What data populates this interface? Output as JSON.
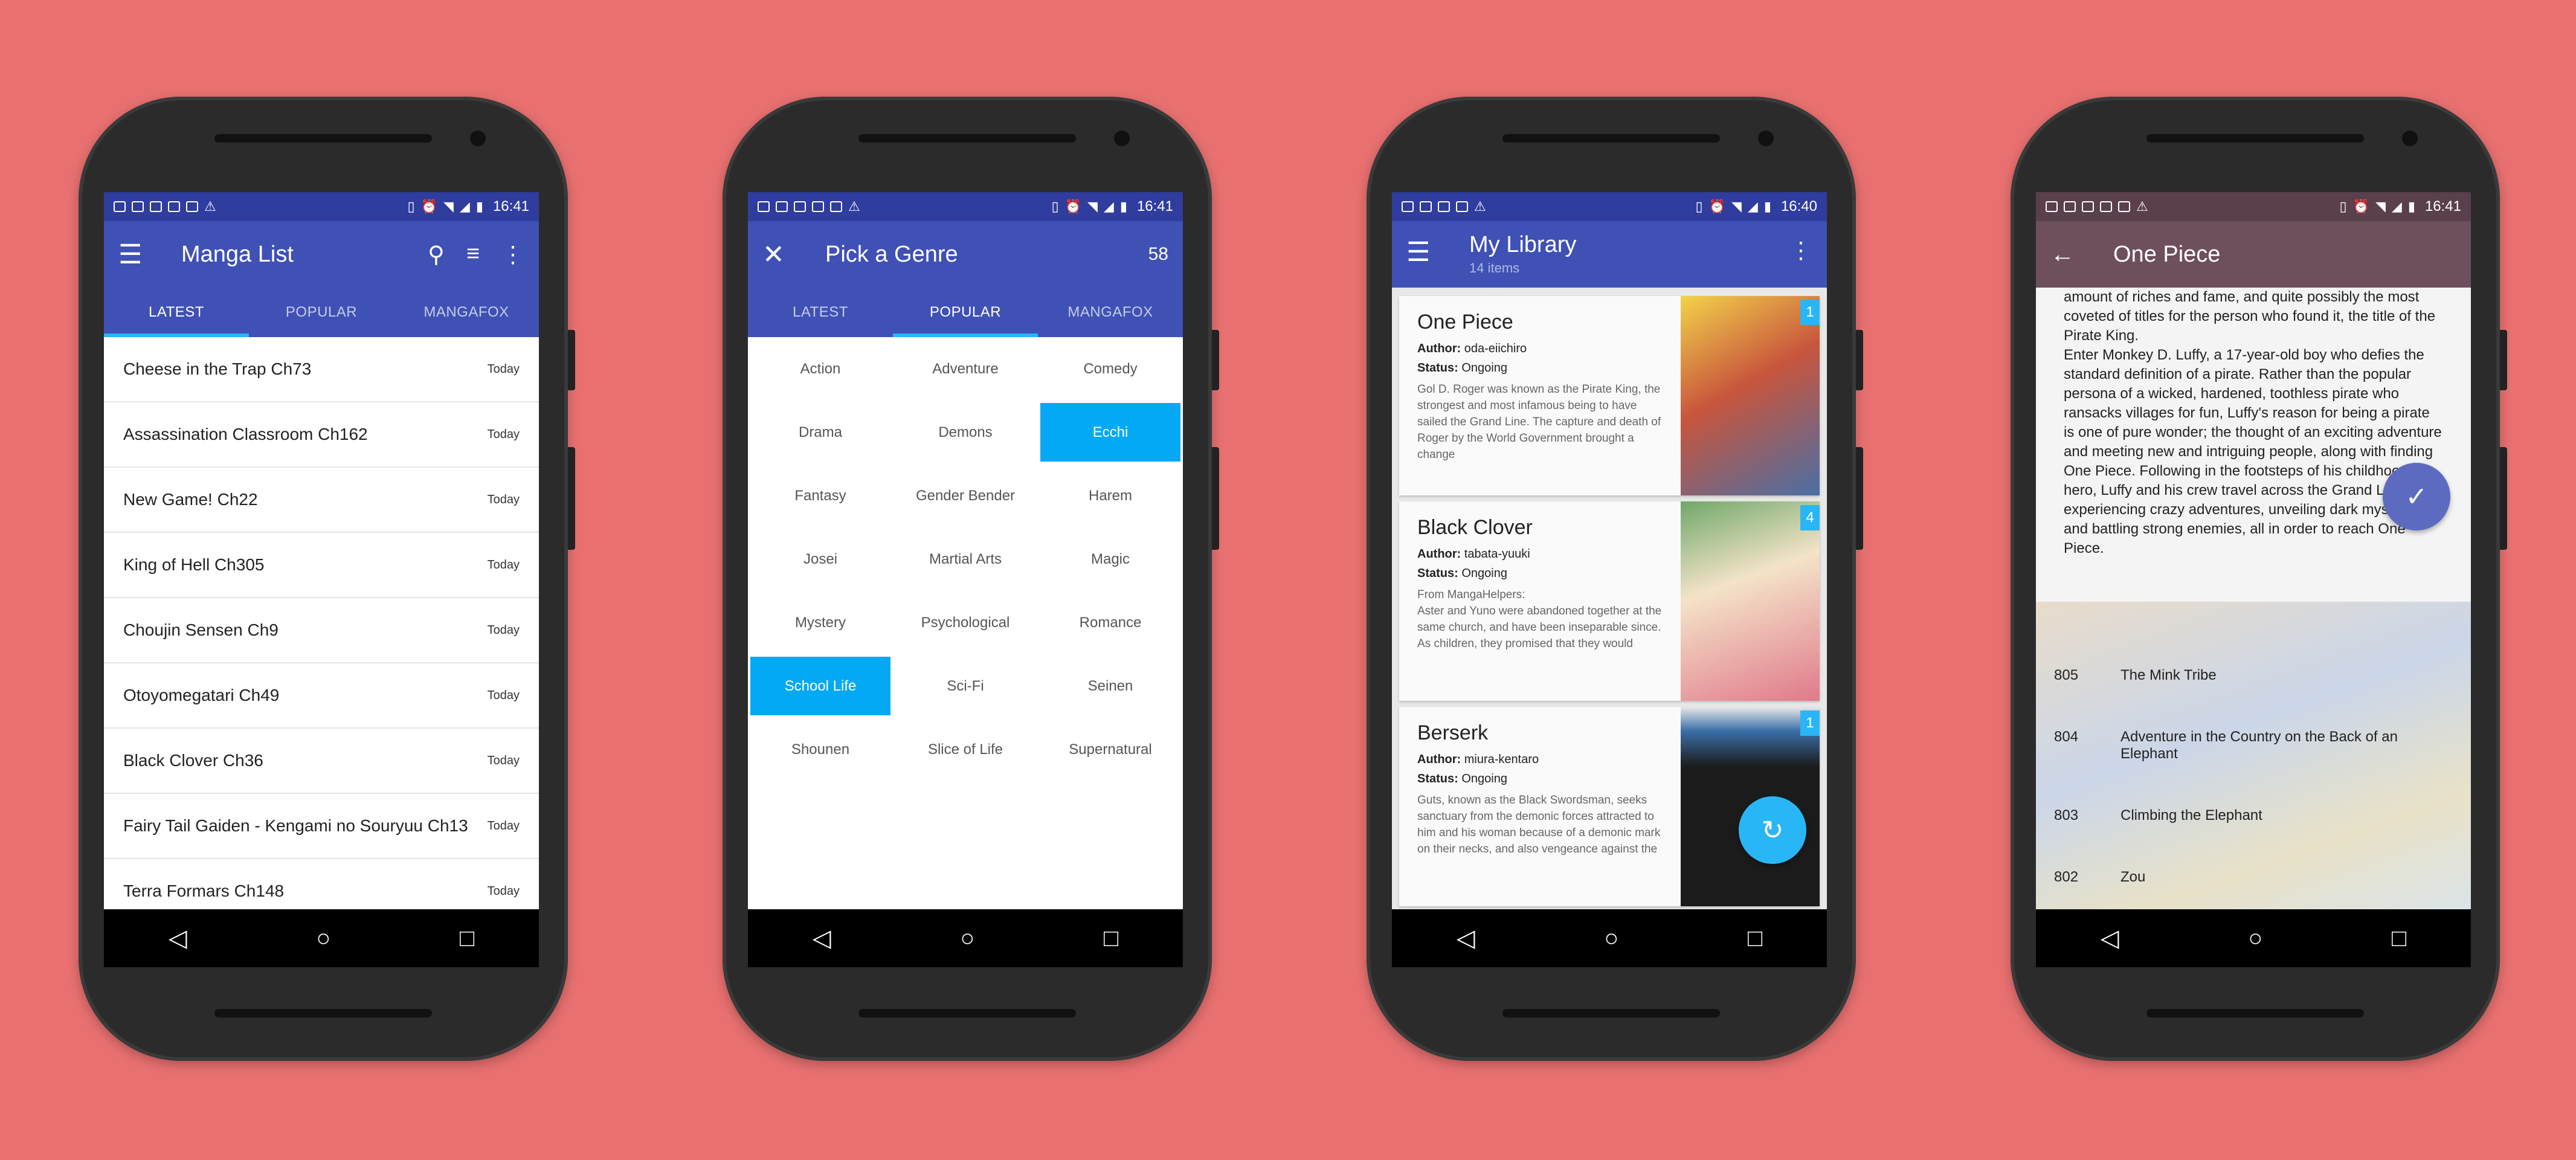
{
  "colors": {
    "background": "#e87070",
    "primary": "#3f51b5",
    "primary_dark": "#2f3d9e",
    "accent": "#29b6f6",
    "detail_bar": "#6d4f5e"
  },
  "phone1": {
    "status_time": "16:41",
    "title": "Manga List",
    "icons": [
      "menu-icon",
      "search-icon",
      "filter-icon",
      "more-vert-icon"
    ],
    "tabs": [
      {
        "label": "LATEST"
      },
      {
        "label": "POPULAR"
      },
      {
        "label": "MANGAFOX"
      }
    ],
    "items": [
      {
        "title": "Cheese in the Trap Ch73",
        "when": "Today"
      },
      {
        "title": "Assassination Classroom Ch162",
        "when": "Today"
      },
      {
        "title": "New Game! Ch22",
        "when": "Today"
      },
      {
        "title": "King of Hell Ch305",
        "when": "Today"
      },
      {
        "title": "Choujin Sensen Ch9",
        "when": "Today"
      },
      {
        "title": "Otoyomegatari Ch49",
        "when": "Today"
      },
      {
        "title": "Black Clover Ch36",
        "when": "Today"
      },
      {
        "title": "Fairy Tail Gaiden - Kengami no Souryuu Ch13",
        "when": "Today"
      },
      {
        "title": "Terra Formars Ch148",
        "when": "Today"
      }
    ]
  },
  "phone2": {
    "status_time": "16:41",
    "title": "Pick a Genre",
    "count": "58",
    "tabs": [
      {
        "label": "LATEST"
      },
      {
        "label": "POPULAR"
      },
      {
        "label": "MANGAFOX"
      }
    ],
    "genres": [
      "Action",
      "Adventure",
      "Comedy",
      "Drama",
      "Demons",
      "Ecchi",
      "Fantasy",
      "Gender Bender",
      "Harem",
      "Josei",
      "Martial Arts",
      "Magic",
      "Mystery",
      "Psychological",
      "Romance",
      "School Life",
      "Sci-Fi",
      "Seinen",
      "Shounen",
      "Slice of Life",
      "Supernatural"
    ],
    "selected": [
      "Ecchi",
      "School Life"
    ]
  },
  "phone3": {
    "status_time": "16:40",
    "title": "My Library",
    "subtitle": "14 items",
    "labels": {
      "author": "Author:",
      "status": "Status:"
    },
    "cards": [
      {
        "name": "One Piece",
        "author": "oda-eiichiro",
        "status": "Ongoing",
        "desc": "Gol D. Roger was known as the Pirate King, the strongest and most infamous being to have sailed the Grand Line. The capture and death of Roger by the World Government brought a change",
        "badge": "1",
        "cover_colors": [
          "#f2d34a",
          "#c8553d",
          "#4a6fa5"
        ]
      },
      {
        "name": "Black Clover",
        "author": "tabata-yuuki",
        "status": "Ongoing",
        "desc": "From MangaHelpers:\nAster and Yuno were abandoned together at the same church, and have been inseparable since. As children, they promised that they would",
        "badge": "4",
        "cover_colors": [
          "#6fa86a",
          "#e07a8b",
          "#f4e3c8"
        ]
      },
      {
        "name": "Berserk",
        "author": "miura-kentaro",
        "status": "Ongoing",
        "desc": "Guts, known as the Black Swordsman, seeks sanctuary from the demonic forces attracted to him and his woman because of a demonic mark on their necks, and also vengeance against the",
        "badge": "1",
        "cover_colors": [
          "#1b1b1b",
          "#3a6fa8",
          "#e8e8e8"
        ]
      }
    ]
  },
  "phone4": {
    "status_time": "16:41",
    "title": "One Piece",
    "synopsis": "amount of riches and fame, and quite possibly the most coveted of titles for the person who found it, the title of the Pirate King.\nEnter Monkey D. Luffy, a 17-year-old boy who defies the standard definition of a pirate. Rather than the popular persona of a wicked, hardened, toothless pirate who ransacks villages for fun, Luffy's reason for being a pirate is one of pure wonder; the thought of an exciting adventure and meeting new and intriguing people, along with finding One Piece. Following in the footsteps of his childhood hero, Luffy and his crew travel across the Grand Line, experiencing crazy adventures, unveiling dark mysteries and battling strong enemies, all in order to reach One Piece.",
    "chapters": [
      {
        "num": "805",
        "title": "The Mink Tribe"
      },
      {
        "num": "804",
        "title": "Adventure in the Country on the Back of an Elephant"
      },
      {
        "num": "803",
        "title": "Climbing the Elephant"
      },
      {
        "num": "802",
        "title": "Zou"
      }
    ]
  }
}
